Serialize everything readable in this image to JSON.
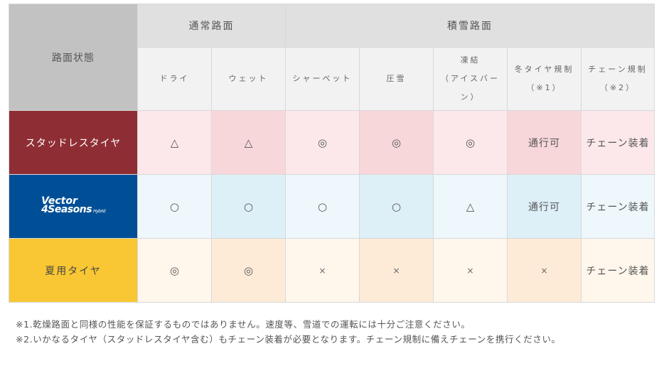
{
  "table": {
    "corner_label": "路面状態",
    "groups": [
      {
        "label": "通常路面"
      },
      {
        "label": "積雪路面"
      }
    ],
    "sub_headers": [
      {
        "line1": "ドライ",
        "line2": ""
      },
      {
        "line1": "ウェット",
        "line2": ""
      },
      {
        "line1": "シャーベット",
        "line2": ""
      },
      {
        "line1": "圧雪",
        "line2": ""
      },
      {
        "line1": "凍結",
        "line2": "（アイスバーン）"
      },
      {
        "line1": "冬タイヤ規制",
        "line2": "（※1）"
      },
      {
        "line1": "チェーン規制",
        "line2": "（※2）"
      }
    ],
    "rows": [
      {
        "label": "スタッドレスタイヤ",
        "cells": [
          "△",
          "△",
          "◎",
          "◎",
          "◎",
          "通行可",
          "チェーン装着"
        ]
      },
      {
        "label": "",
        "logo_line1": "Vector",
        "logo_line2": "4Seasons",
        "logo_suffix": "Hybrid",
        "cells": [
          "○",
          "○",
          "○",
          "○",
          "△",
          "通行可",
          "チェーン装着"
        ]
      },
      {
        "label": "夏用タイヤ",
        "cells": [
          "◎",
          "◎",
          "×",
          "×",
          "×",
          "×",
          "チェーン装着"
        ]
      }
    ]
  },
  "notes": [
    {
      "mark": "※1.",
      "text": "乾燥路面と同様の性能を保証するものではありません。速度等、雪道での運転には十分ご注意ください。"
    },
    {
      "mark": "※2.",
      "text": "いかなるタイヤ（スタッドレスタイヤ含む）もチェーン装着が必要となります。チェーン規制に備えチェーンを携行ください。"
    }
  ],
  "colors": {
    "studless": "#8e2e34",
    "vector": "#004f96",
    "summer": "#f9c733"
  }
}
